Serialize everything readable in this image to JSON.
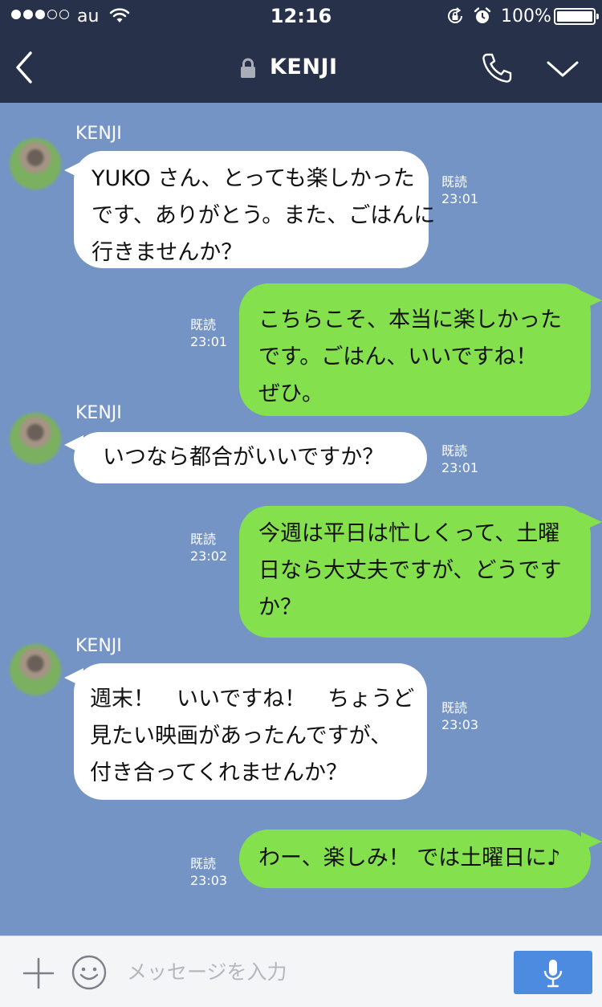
{
  "status_bar": {
    "carrier": "au",
    "time": "12:16",
    "battery_percent": "100%",
    "signal_strength": 3,
    "signal_max": 5,
    "battery_level": 1.0
  },
  "header": {
    "title": "KENJI",
    "icons": [
      "back-icon",
      "lock-icon",
      "phone-icon",
      "chevron-down-icon"
    ]
  },
  "messages": [
    {
      "side": "in",
      "sender": "KENJI",
      "text": "YUKO さん、とっても楽しかった\nです、ありがとう。また、ごはんに\n行きませんか？",
      "read": "既読",
      "time": "23:01"
    },
    {
      "side": "out",
      "text": "こちらこそ、本当に楽しかった\nです。ごはん、いいですね！\nぜひ。",
      "read": "既読",
      "time": "23:01"
    },
    {
      "side": "in",
      "sender": "KENJI",
      "text": "いつなら都合がいいですか？",
      "read": "既読",
      "time": "23:01"
    },
    {
      "side": "out",
      "text": "今週は平日は忙しくって、土曜\n日なら大丈夫ですが、どうです\nか？",
      "read": "既読",
      "time": "23:02"
    },
    {
      "side": "in",
      "sender": "KENJI",
      "text": "週末！　いいですね！　ちょうど\n見たい映画があったんですが、\n付き合ってくれませんか？",
      "read": "既読",
      "time": "23:03"
    },
    {
      "side": "out",
      "text": "わー、楽しみ！ では土曜日に♪",
      "read": "既読",
      "time": "23:03"
    }
  ],
  "input_bar": {
    "placeholder": "メッセージを入力",
    "icons": [
      "plus-icon",
      "smiley-icon",
      "microphone-icon"
    ]
  },
  "colors": {
    "header_bg": "#27324a",
    "chat_bg": "#7494c6",
    "incoming_bubble": "#ffffff",
    "outgoing_bubble": "#84e04d",
    "mic_button": "#4c8be0"
  }
}
